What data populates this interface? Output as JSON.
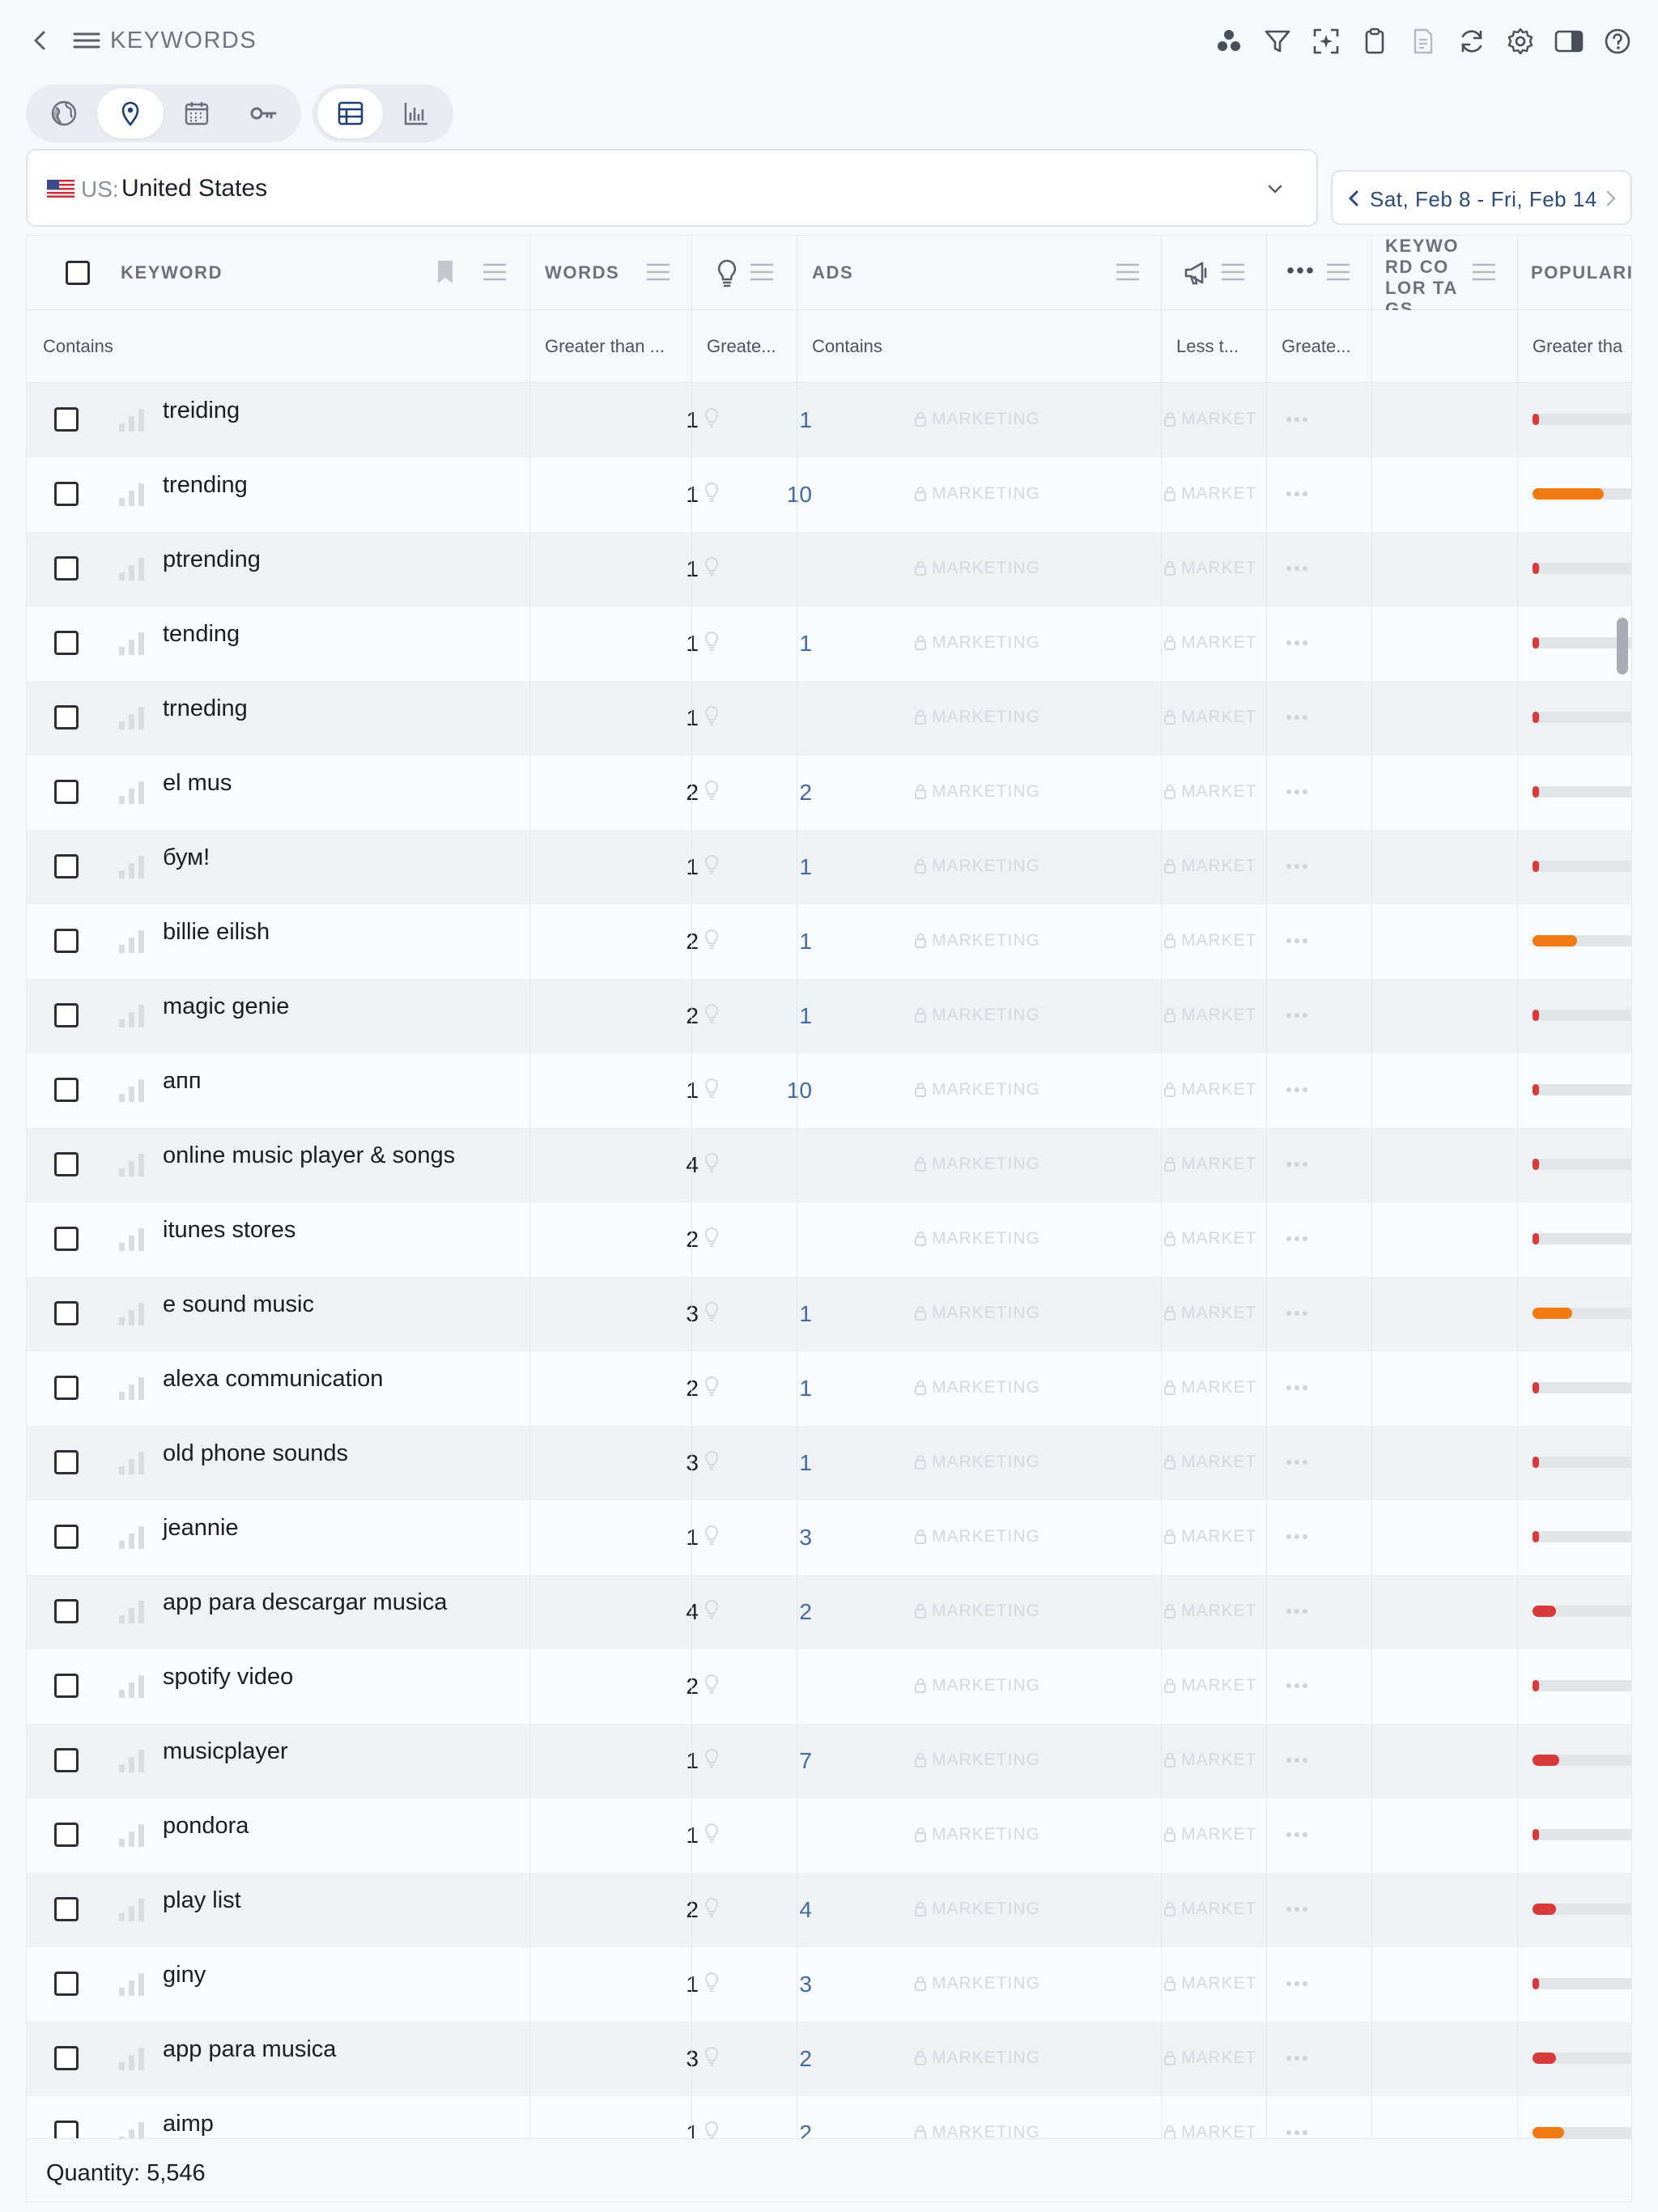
{
  "header": {
    "title": "KEYWORDS",
    "icons": [
      "back-icon",
      "menu-icon",
      "clusters-icon",
      "filter-icon",
      "focus-icon",
      "clipboard-icon",
      "export-icon",
      "refresh-icon",
      "settings-icon",
      "panel-icon",
      "help-icon"
    ]
  },
  "view_switch": {
    "group1": [
      "globe-icon",
      "location-pin-icon",
      "calendar-icon",
      "key-icon"
    ],
    "group1_active": "location-pin-icon",
    "group2": [
      "table-icon",
      "chart-icon"
    ],
    "group2_active": "table-icon"
  },
  "country": {
    "code": "US:",
    "name": "United States"
  },
  "date_range": {
    "label": "Sat, Feb 8 - Fri, Feb 14"
  },
  "columns": {
    "keyword": "KEYWORD",
    "words": "WORDS",
    "ads": "ADS",
    "color_tags": "KEYWO RD COLOR TAGS",
    "popularity": "POPULARI"
  },
  "filters": {
    "keyword": "Contains",
    "words": "Greater than ...",
    "ideas": "Greate...",
    "ads": "Contains",
    "promo": "Less t...",
    "more": "Greate...",
    "popularity": "Greater tha"
  },
  "locked_label": "MARKETING",
  "locked_label_short": "MARKET",
  "rows": [
    {
      "keyword": "treiding",
      "words": "1",
      "ideas": "1",
      "popularity": 0.05,
      "color": "#d83a3a"
    },
    {
      "keyword": "trending",
      "words": "1",
      "ideas": "10",
      "popularity": 0.68,
      "color": "#f07b12"
    },
    {
      "keyword": "ptrending",
      "words": "1",
      "ideas": "",
      "popularity": 0.05,
      "color": "#d83a3a"
    },
    {
      "keyword": "tending",
      "words": "1",
      "ideas": "1",
      "popularity": 0.05,
      "color": "#d83a3a"
    },
    {
      "keyword": "trneding",
      "words": "1",
      "ideas": "",
      "popularity": 0.05,
      "color": "#d83a3a"
    },
    {
      "keyword": "el mus",
      "words": "2",
      "ideas": "2",
      "popularity": 0.05,
      "color": "#d83a3a"
    },
    {
      "keyword": "бум!",
      "words": "1",
      "ideas": "1",
      "popularity": 0.05,
      "color": "#d83a3a"
    },
    {
      "keyword": "billie eilish",
      "words": "2",
      "ideas": "1",
      "popularity": 0.42,
      "color": "#f07b12"
    },
    {
      "keyword": "magic genie",
      "words": "2",
      "ideas": "1",
      "popularity": 0.05,
      "color": "#d83a3a"
    },
    {
      "keyword": "апп",
      "words": "1",
      "ideas": "10",
      "popularity": 0.05,
      "color": "#d83a3a"
    },
    {
      "keyword": "online music player & songs",
      "words": "4",
      "ideas": "",
      "popularity": 0.05,
      "color": "#d83a3a"
    },
    {
      "keyword": "itunes stores",
      "words": "2",
      "ideas": "",
      "popularity": 0.05,
      "color": "#d83a3a"
    },
    {
      "keyword": "e sound music",
      "words": "3",
      "ideas": "1",
      "popularity": 0.38,
      "color": "#f07b12"
    },
    {
      "keyword": "alexa communication",
      "words": "2",
      "ideas": "1",
      "popularity": 0.05,
      "color": "#d83a3a"
    },
    {
      "keyword": "old phone sounds",
      "words": "3",
      "ideas": "1",
      "popularity": 0.05,
      "color": "#d83a3a"
    },
    {
      "keyword": "jeannie",
      "words": "1",
      "ideas": "3",
      "popularity": 0.05,
      "color": "#d83a3a"
    },
    {
      "keyword": "app para descargar musica",
      "words": "4",
      "ideas": "2",
      "popularity": 0.22,
      "color": "#d83a3a"
    },
    {
      "keyword": "spotify video",
      "words": "2",
      "ideas": "",
      "popularity": 0.05,
      "color": "#d83a3a"
    },
    {
      "keyword": "musicplayer",
      "words": "1",
      "ideas": "7",
      "popularity": 0.25,
      "color": "#d83a3a"
    },
    {
      "keyword": "pondora",
      "words": "1",
      "ideas": "",
      "popularity": 0.05,
      "color": "#d83a3a"
    },
    {
      "keyword": "play list",
      "words": "2",
      "ideas": "4",
      "popularity": 0.22,
      "color": "#d83a3a"
    },
    {
      "keyword": "giny",
      "words": "1",
      "ideas": "3",
      "popularity": 0.05,
      "color": "#d83a3a"
    },
    {
      "keyword": "app para musica",
      "words": "3",
      "ideas": "2",
      "popularity": 0.22,
      "color": "#d83a3a"
    },
    {
      "keyword": "aimp",
      "words": "1",
      "ideas": "2",
      "popularity": 0.3,
      "color": "#f07b12"
    }
  ],
  "footer": {
    "quantity": "Quantity: 5,546"
  }
}
